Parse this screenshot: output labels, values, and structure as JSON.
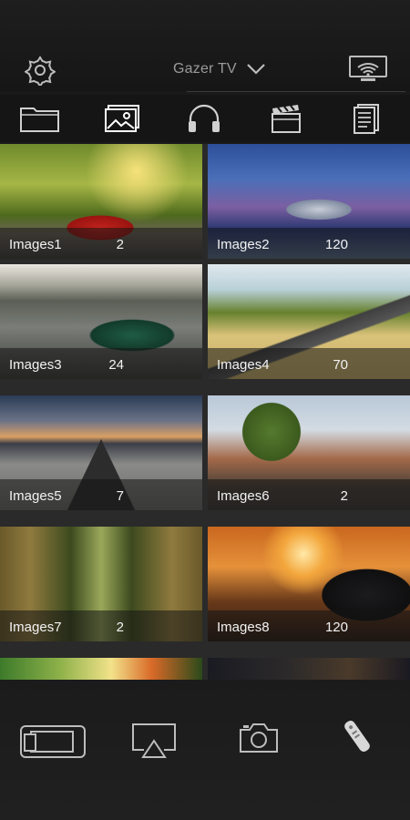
{
  "header": {
    "title": "Gazer TV",
    "icons": [
      "gear-icon",
      "chevron-down-icon",
      "cast-icon"
    ]
  },
  "tabs": [
    {
      "name": "folder",
      "icon": "folder-icon"
    },
    {
      "name": "images",
      "icon": "image-icon",
      "active": true
    },
    {
      "name": "music",
      "icon": "headphones-icon"
    },
    {
      "name": "video",
      "icon": "clapperboard-icon"
    },
    {
      "name": "documents",
      "icon": "document-icon"
    }
  ],
  "albums": [
    {
      "name": "Images1",
      "count": "2"
    },
    {
      "name": "Images2",
      "count": "120"
    },
    {
      "name": "Images3",
      "count": "24"
    },
    {
      "name": "Images4",
      "count": "70"
    },
    {
      "name": "Images5",
      "count": "7"
    },
    {
      "name": "Images6",
      "count": "2"
    },
    {
      "name": "Images7",
      "count": "2"
    },
    {
      "name": "Images8",
      "count": "120"
    }
  ],
  "bottom_bar": {
    "icons": [
      "screen-mirror-icon",
      "airplay-icon",
      "camera-icon",
      "remote-icon"
    ]
  },
  "colors": {
    "background": "#1a1a1a",
    "icon": "#cfcfcf",
    "muted_text": "#9a9a9a"
  }
}
